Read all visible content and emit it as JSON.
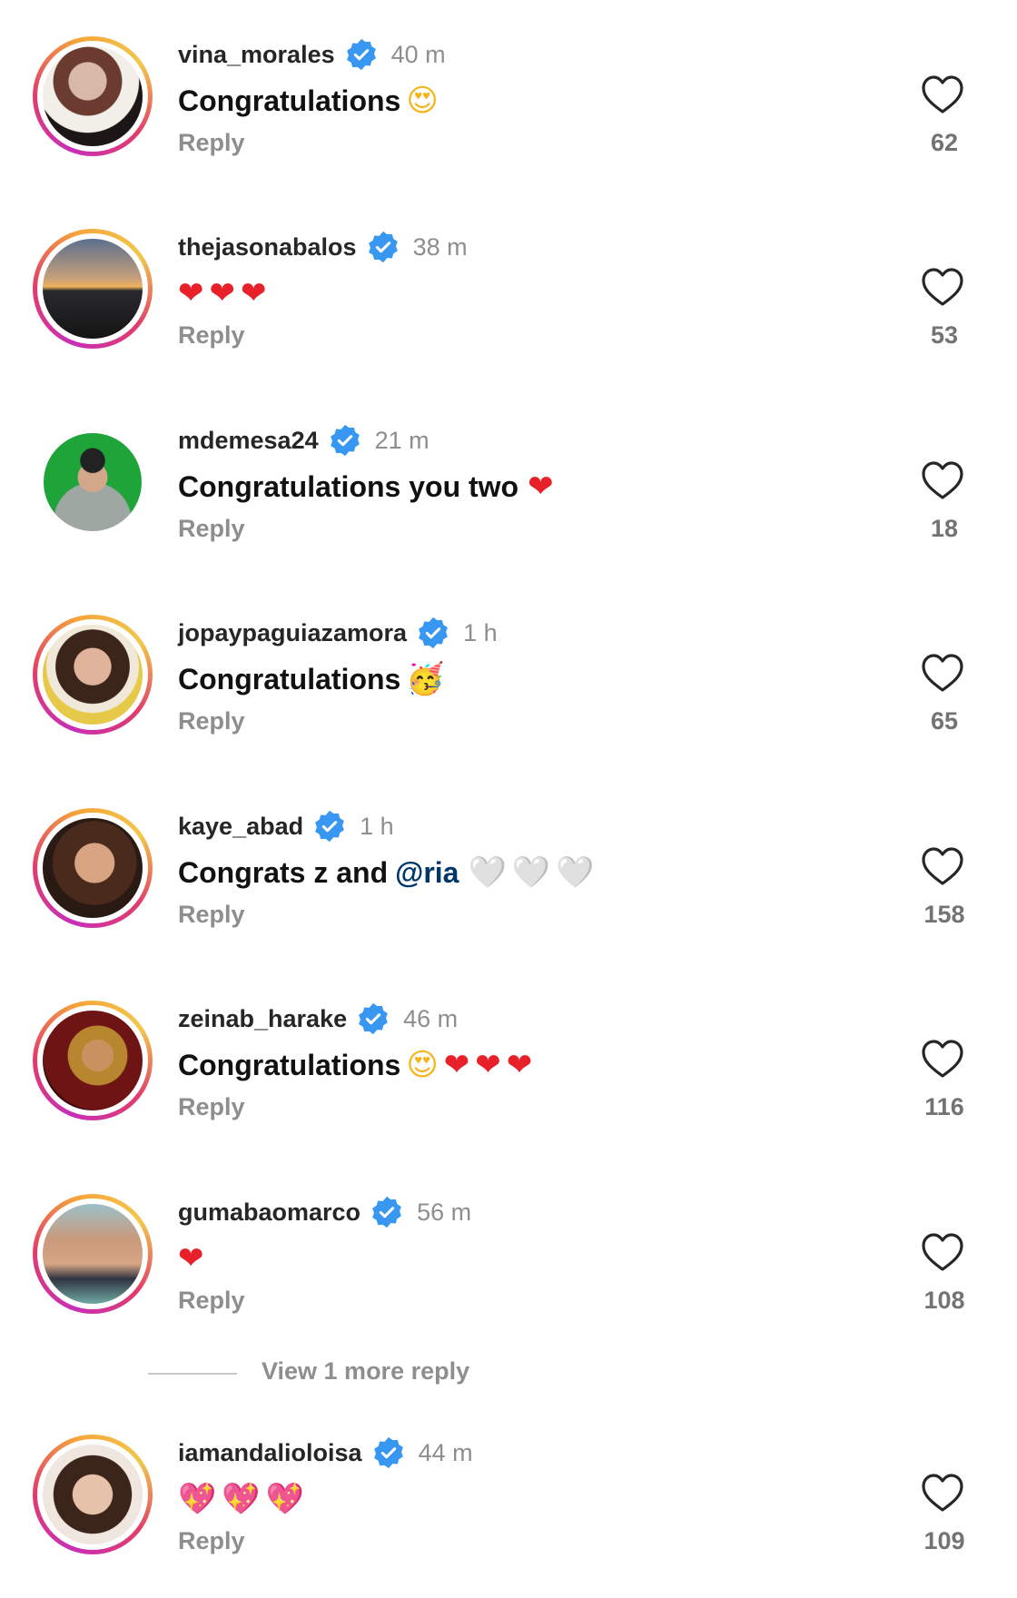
{
  "comments": [
    {
      "username": "vina_morales",
      "time": "40 m",
      "text": "Congratulations",
      "mention": "",
      "emojis": [
        "😍"
      ],
      "reply": "Reply",
      "likes": "62"
    },
    {
      "username": "thejasonabalos",
      "time": "38 m",
      "text": "",
      "mention": "",
      "emojis": [
        "❤",
        "❤",
        "❤"
      ],
      "reply": "Reply",
      "likes": "53"
    },
    {
      "username": "mdemesa24",
      "time": "21 m",
      "text": "Congratulations you two",
      "mention": "",
      "emojis": [
        "❤"
      ],
      "reply": "Reply",
      "likes": "18"
    },
    {
      "username": "jopaypaguiazamora",
      "time": "1 h",
      "text": "Congratulations",
      "mention": "",
      "emojis": [
        "🥳"
      ],
      "reply": "Reply",
      "likes": "65"
    },
    {
      "username": "kaye_abad",
      "time": "1 h",
      "text": "Congrats z and",
      "mention": "@ria",
      "emojis": [
        "🤍",
        "🤍",
        "🤍"
      ],
      "reply": "Reply",
      "likes": "158"
    },
    {
      "username": "zeinab_harake",
      "time": "46 m",
      "text": "Congratulations",
      "mention": "",
      "emojis": [
        "😍",
        "❤",
        "❤",
        "❤"
      ],
      "reply": "Reply",
      "likes": "116"
    },
    {
      "username": "gumabaomarco",
      "time": "56 m",
      "text": "",
      "mention": "",
      "emojis": [
        "❤"
      ],
      "reply": "Reply",
      "likes": "108"
    },
    {
      "username": "iamandalioloisa",
      "time": "44 m",
      "text": "",
      "mention": "",
      "emojis": [
        "💖",
        "💖",
        "💖"
      ],
      "reply": "Reply",
      "likes": "109"
    }
  ],
  "view_more": "View 1 more reply",
  "colors": {
    "verified": "#3897f0",
    "muted": "#8e8e8e",
    "mention": "#00376b",
    "heart_red": "#e8202a"
  },
  "icons": {
    "verified": "verified-badge-icon",
    "like": "heart-outline-icon"
  }
}
